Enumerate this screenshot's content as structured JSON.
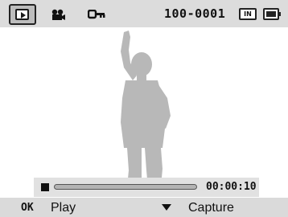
{
  "top_bar": {
    "mode_icon": "playback-icon",
    "video_icon": "movie-camera-icon",
    "protect_icon": "key-icon",
    "file_number": "100-0001",
    "memory_icon": "internal-memory-icon",
    "memory_label": "IN",
    "battery_icon": "battery-full-icon"
  },
  "player": {
    "stop_icon": "stop-icon",
    "progress": 0.0,
    "elapsed_time": "00:00:10"
  },
  "bottom_bar": {
    "ok_key": "OK",
    "ok_action": "Play",
    "down_icon": "down-arrow-icon",
    "down_action": "Capture"
  },
  "colors": {
    "bar_background": "#dadada",
    "icon_dark": "#111111",
    "silhouette": "#b8b8b8"
  }
}
